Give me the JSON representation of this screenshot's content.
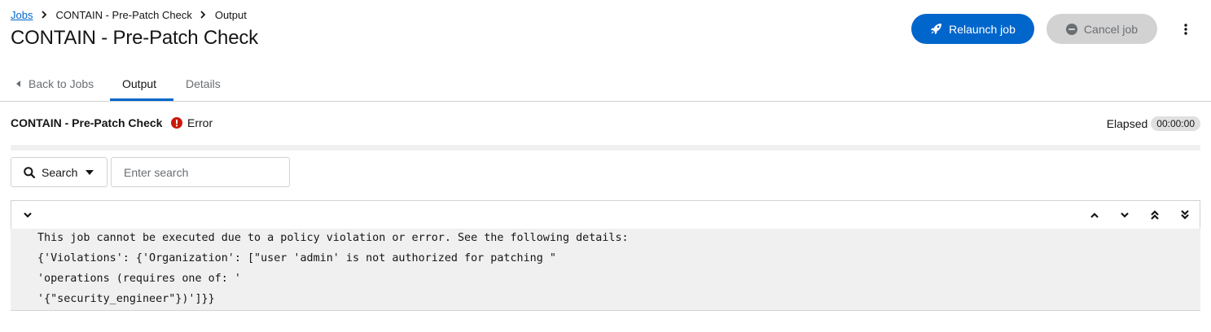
{
  "breadcrumb": {
    "items": [
      {
        "label": "Jobs",
        "link": true
      },
      {
        "label": "CONTAIN - Pre-Patch Check",
        "link": false
      },
      {
        "label": "Output",
        "link": false
      }
    ]
  },
  "header": {
    "title": "CONTAIN - Pre-Patch Check",
    "relaunch_label": "Relaunch job",
    "cancel_label": "Cancel job"
  },
  "tabs": [
    {
      "label": "Back to Jobs"
    },
    {
      "label": "Output",
      "active": true
    },
    {
      "label": "Details"
    }
  ],
  "job": {
    "name": "CONTAIN - Pre-Patch Check",
    "status": "Error",
    "status_color": "#c9190b",
    "elapsed_label": "Elapsed",
    "elapsed_value": "00:00:00"
  },
  "search": {
    "select_label": "Search",
    "placeholder": "Enter search"
  },
  "output": {
    "lines": [
      "This job cannot be executed due to a policy violation or error. See the following details:",
      "{'Violations': {'Organization': [\"user 'admin' is not authorized for patching \"",
      "'operations (requires one of: '",
      "'{\"security_engineer\"})']}}"
    ]
  },
  "colors": {
    "accent": "#0066cc",
    "error": "#c9190b"
  }
}
